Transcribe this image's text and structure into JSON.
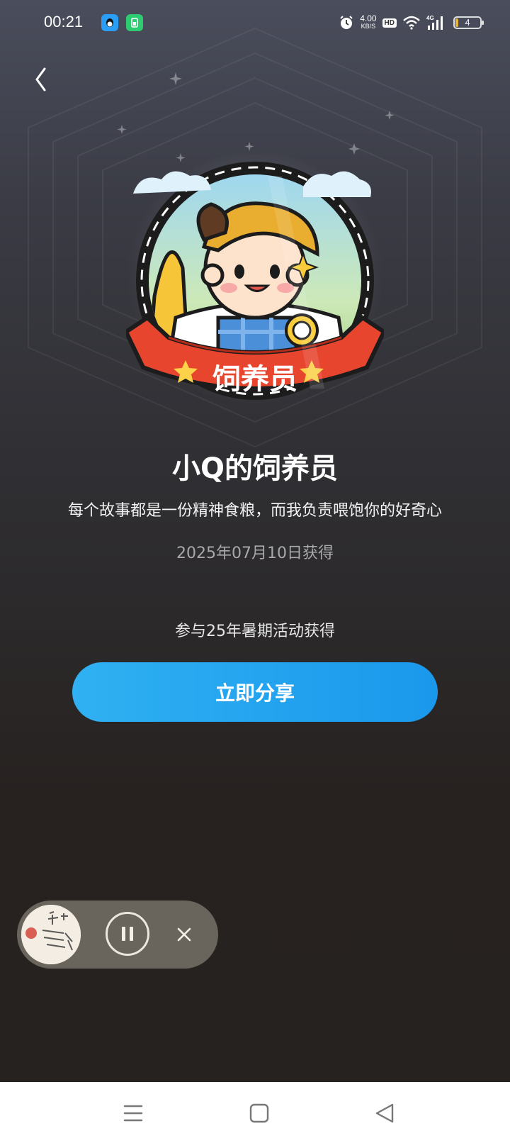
{
  "status_bar": {
    "time": "00:21",
    "net_speed_value": "4.00",
    "net_speed_unit": "KB/S",
    "hd_label": "HD",
    "signal_label": "4G",
    "battery_level": "4",
    "icons": [
      "qq-app-icon",
      "battery-saver-app-icon",
      "alarm-icon",
      "wifi-icon",
      "cellular-signal-icon",
      "battery-icon"
    ]
  },
  "header": {
    "back_icon": "chevron-left-icon"
  },
  "badge": {
    "title": "小Q的饲养员",
    "ribbon_text": "饲养员",
    "description": "每个故事都是一份精神食粮，而我负责喂饱你的好奇心",
    "obtained_date": "2025年07月10日获得",
    "source": "参与25年暑期活动获得",
    "share_label": "立即分享"
  },
  "mini_player": {
    "state": "playing",
    "icons": [
      "pause-icon",
      "close-icon"
    ]
  },
  "nav_bar": {
    "icons": [
      "menu-icon",
      "home-icon",
      "back-triangle-icon"
    ]
  },
  "colors": {
    "share_button": "#1f9fee",
    "player_bg": "#6a655c",
    "ribbon": "#e8452e"
  }
}
